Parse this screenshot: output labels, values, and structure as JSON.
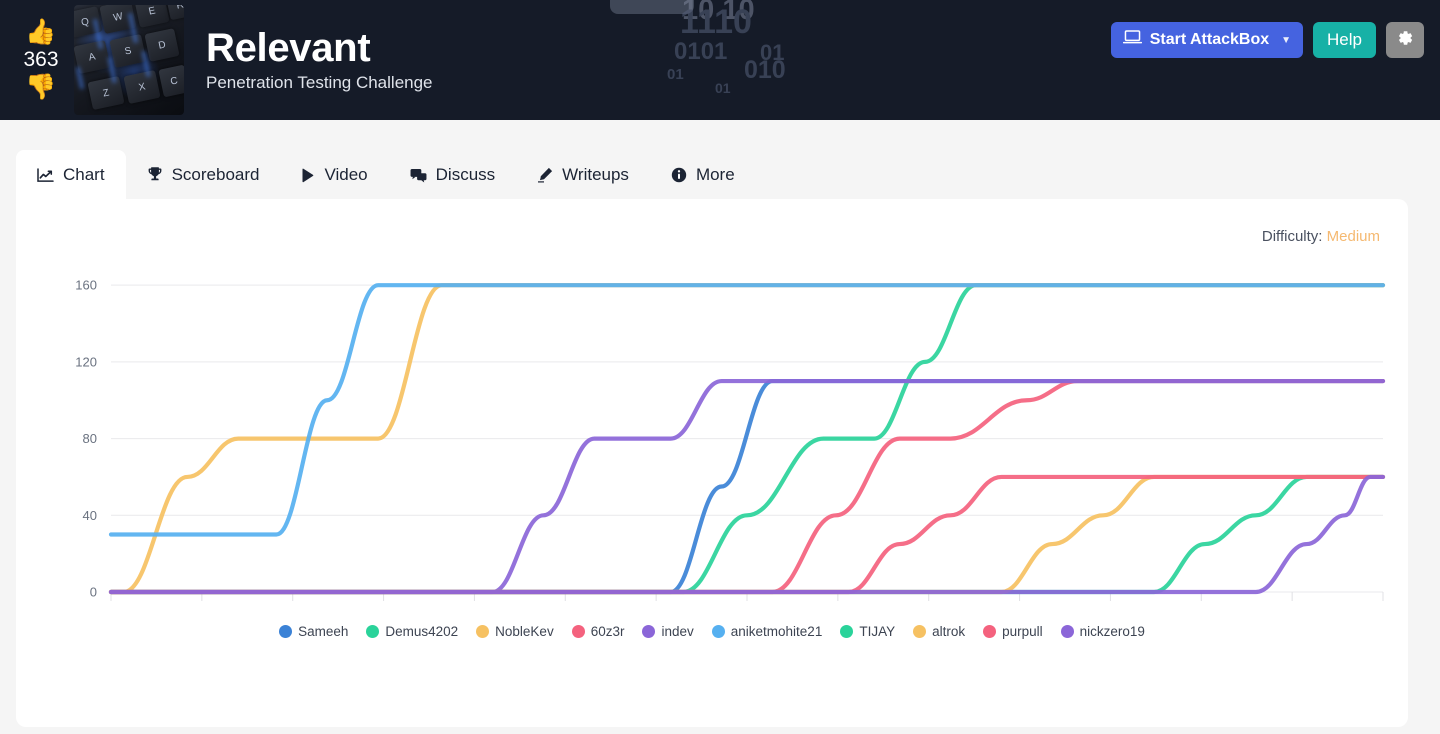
{
  "header": {
    "vote_count": "363",
    "thumbs_up_icon": "thumbs-up-icon",
    "thumbs_down_icon": "thumbs-down-icon",
    "room_title": "Relevant",
    "room_subtitle": "Penetration Testing Challenge",
    "binary_decoration": [
      "1110",
      "0101",
      "01",
      "01",
      "010",
      "01",
      "10 10"
    ],
    "actions": {
      "attackbox_label": "Start AttackBox",
      "attackbox_icon": "laptop-icon",
      "attackbox_caret": "▼",
      "help_label": "Help",
      "gear_icon": "gear-icon"
    },
    "colors": {
      "background": "#151b28",
      "attackbox": "#4563e0",
      "help": "#17b1a6",
      "gear": "#8a8a8a"
    }
  },
  "tabs": [
    {
      "label": "Chart",
      "icon": "chart-line-icon",
      "active": true
    },
    {
      "label": "Scoreboard",
      "icon": "trophy-icon",
      "active": false
    },
    {
      "label": "Video",
      "icon": "play-icon",
      "active": false
    },
    {
      "label": "Discuss",
      "icon": "comments-icon",
      "active": false
    },
    {
      "label": "Writeups",
      "icon": "pencil-icon",
      "active": false
    },
    {
      "label": "More",
      "icon": "info-circle-icon",
      "active": false
    }
  ],
  "difficulty": {
    "label": "Difficulty:",
    "value": "Medium",
    "value_color": "#f5b971"
  },
  "chart_data": {
    "type": "line",
    "title": "",
    "xlabel": "",
    "ylabel": "",
    "ylim": [
      0,
      170
    ],
    "yticks": [
      0,
      40,
      80,
      120,
      160
    ],
    "xlim": [
      0,
      100
    ],
    "grid": true,
    "legend_position": "bottom",
    "note": "Cumulative points over time per user; step-shaped curves",
    "series": [
      {
        "name": "Sameeh",
        "color": "#3b82d6",
        "x": [
          0,
          44,
          48,
          52,
          100
        ],
        "values": [
          0,
          0,
          55,
          110,
          110
        ]
      },
      {
        "name": "Demus4202",
        "color": "#2ad39a",
        "x": [
          0,
          45,
          50,
          56,
          60,
          64,
          68,
          100
        ],
        "values": [
          0,
          0,
          40,
          80,
          80,
          120,
          160,
          160
        ]
      },
      {
        "name": "NobleKev",
        "color": "#f6c162",
        "x": [
          0,
          1,
          6,
          10,
          21,
          26,
          100
        ],
        "values": [
          0,
          0,
          60,
          80,
          80,
          160,
          160
        ]
      },
      {
        "name": "60z3r",
        "color": "#f4627e",
        "x": [
          0,
          52,
          57,
          62,
          66,
          72,
          76,
          100
        ],
        "values": [
          0,
          0,
          40,
          80,
          80,
          100,
          110,
          110
        ]
      },
      {
        "name": "indev",
        "color": "#8b66d8",
        "x": [
          0,
          30,
          34,
          38,
          44,
          48,
          100
        ],
        "values": [
          0,
          0,
          40,
          80,
          80,
          110,
          110
        ]
      },
      {
        "name": "aniketmohite21",
        "color": "#56b0f0",
        "x": [
          0,
          13,
          17,
          21,
          100
        ],
        "values": [
          30,
          30,
          100,
          160,
          160
        ]
      },
      {
        "name": "TIJAY",
        "color": "#2ad39a",
        "x": [
          0,
          82,
          86,
          90,
          94,
          100
        ],
        "values": [
          0,
          0,
          25,
          40,
          60,
          60
        ]
      },
      {
        "name": "altrok",
        "color": "#f6c162",
        "x": [
          0,
          70,
          74,
          78,
          82,
          100
        ],
        "values": [
          0,
          0,
          25,
          40,
          60,
          60
        ]
      },
      {
        "name": "purpull",
        "color": "#f4627e",
        "x": [
          0,
          58,
          62,
          66,
          70,
          100
        ],
        "values": [
          0,
          0,
          25,
          40,
          60,
          60
        ]
      },
      {
        "name": "nickzero19",
        "color": "#8b66d8",
        "x": [
          0,
          90,
          94,
          97,
          99,
          100
        ],
        "values": [
          0,
          0,
          25,
          40,
          60,
          60
        ]
      }
    ]
  }
}
